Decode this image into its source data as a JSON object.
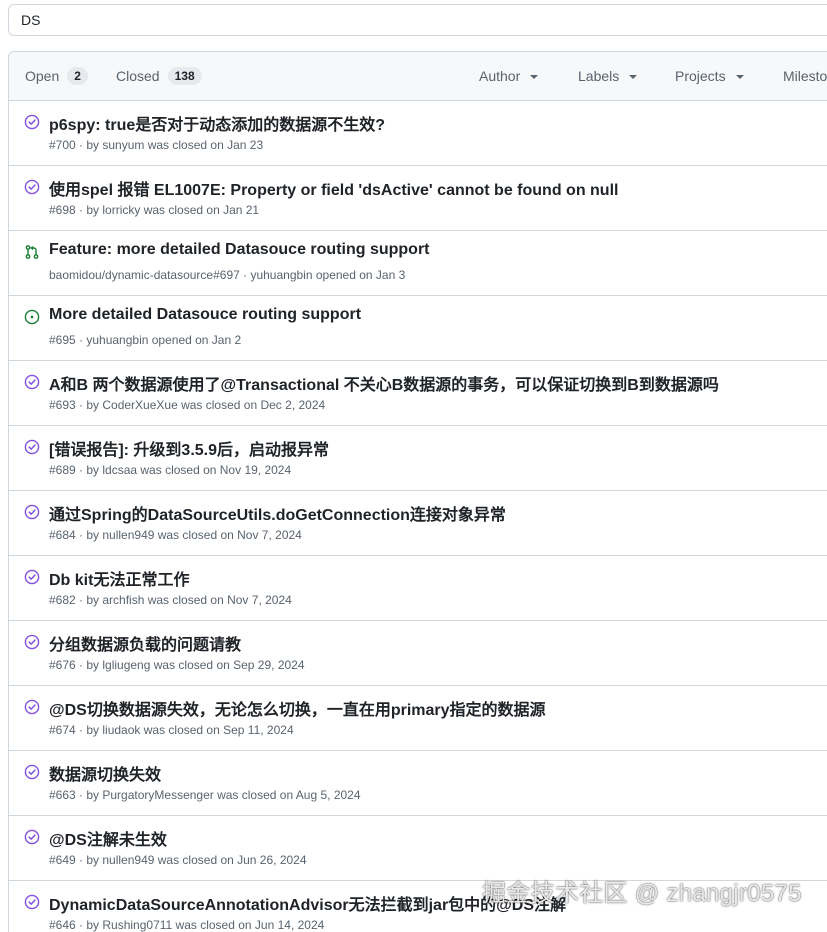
{
  "search": {
    "value": "DS"
  },
  "header": {
    "open_label": "Open",
    "open_count": "2",
    "closed_label": "Closed",
    "closed_count": "138",
    "filters": [
      "Author",
      "Labels",
      "Projects",
      "Milestones"
    ]
  },
  "colors": {
    "closed": "#8250df",
    "open": "#1a7f37"
  },
  "issues": [
    {
      "status": "closed",
      "icon": "issue-closed-icon",
      "title": "p6spy: true是否对于动态添加的数据源不生效?",
      "meta": "#700 · by sunyum was closed on Jan 23"
    },
    {
      "status": "closed",
      "icon": "issue-closed-icon",
      "title": "使用spel 报错 EL1007E: Property or field 'dsActive' cannot be found on null",
      "meta": "#698 · by lorricky was closed on Jan 21"
    },
    {
      "status": "open-pr",
      "icon": "pull-request-icon",
      "title": "Feature: more detailed Datasouce routing support",
      "meta": "baomidou/dynamic-datasource#697 · yuhuangbin opened on Jan 3"
    },
    {
      "status": "open",
      "icon": "issue-opened-icon",
      "title": "More detailed Datasouce routing support",
      "meta": "#695 · yuhuangbin opened on Jan 2"
    },
    {
      "status": "closed",
      "icon": "issue-closed-icon",
      "title": "A和B 两个数据源使用了@Transactional 不关心B数据源的事务，可以保证切换到B到数据源吗",
      "meta": "#693 · by CoderXueXue was closed on Dec 2, 2024"
    },
    {
      "status": "closed",
      "icon": "issue-closed-icon",
      "title": "[错误报告]: 升级到3.5.9后，启动报异常",
      "meta": "#689 · by ldcsaa was closed on Nov 19, 2024"
    },
    {
      "status": "closed",
      "icon": "issue-closed-icon",
      "title": "通过Spring的DataSourceUtils.doGetConnection连接对象异常",
      "meta": "#684 · by nullen949 was closed on Nov 7, 2024"
    },
    {
      "status": "closed",
      "icon": "issue-closed-icon",
      "title": "Db kit无法正常工作",
      "meta": "#682 · by archfish was closed on Nov 7, 2024"
    },
    {
      "status": "closed",
      "icon": "issue-closed-icon",
      "title": "分组数据源负载的问题请教",
      "meta": "#676 · by lgliugeng was closed on Sep 29, 2024"
    },
    {
      "status": "closed",
      "icon": "issue-closed-icon",
      "title": "@DS切换数据源失效，无论怎么切换，一直在用primary指定的数据源",
      "meta": "#674 · by liudaok was closed on Sep 11, 2024"
    },
    {
      "status": "closed",
      "icon": "issue-closed-icon",
      "title": "数据源切换失效",
      "meta": "#663 · by PurgatoryMessenger was closed on Aug 5, 2024"
    },
    {
      "status": "closed",
      "icon": "issue-closed-icon",
      "title": "@DS注解未生效",
      "meta": "#649 · by nullen949 was closed on Jun 26, 2024"
    },
    {
      "status": "closed",
      "icon": "issue-closed-icon",
      "title": "DynamicDataSourceAnnotationAdvisor无法拦截到jar包中的@DS注解",
      "meta": "#646 · by Rushing0711 was closed on Jun 14, 2024"
    }
  ],
  "watermark": "掘金技术社区 @ zhangjr0575"
}
